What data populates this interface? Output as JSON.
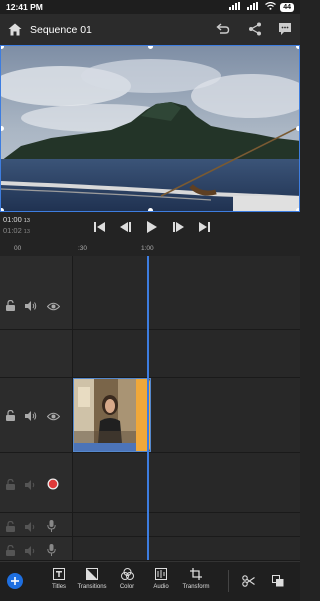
{
  "status": {
    "time": "12:41 PM",
    "battery": "44",
    "carrier_icons": [
      "dual-sim-icon",
      "wifi-icon",
      "signal-icon"
    ]
  },
  "header": {
    "title": "Sequence 01"
  },
  "timecode": {
    "current": "01:00",
    "current_frames": "13",
    "duration": "01:02",
    "duration_frames": "13"
  },
  "ruler": {
    "labels": [
      "00",
      ":30",
      "1:00"
    ]
  },
  "tools": [
    {
      "label": "Titles"
    },
    {
      "label": "Transitions"
    },
    {
      "label": "Color"
    },
    {
      "label": "Audio"
    },
    {
      "label": "Transform"
    }
  ],
  "colors": {
    "accent": "#3d7de0",
    "clip_handle": "#f0a83a",
    "record": "#e03a3a"
  }
}
